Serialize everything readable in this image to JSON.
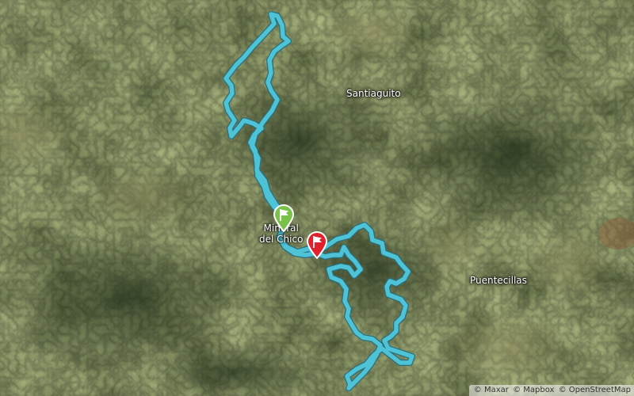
{
  "map": {
    "places": [
      {
        "id": "santiaguito",
        "name": "Santiaguito"
      },
      {
        "id": "mineral-del-chico",
        "line1": "Mineral",
        "line2": "del Chico"
      },
      {
        "id": "puentecillas",
        "name": "Puentecillas"
      }
    ],
    "route_color": "#4fc3d6",
    "start_marker_color": "#78c24a",
    "end_marker_color": "#e0202a",
    "attribution": [
      "© Maxar",
      "© Mapbox",
      "© OpenStreetMap"
    ]
  }
}
